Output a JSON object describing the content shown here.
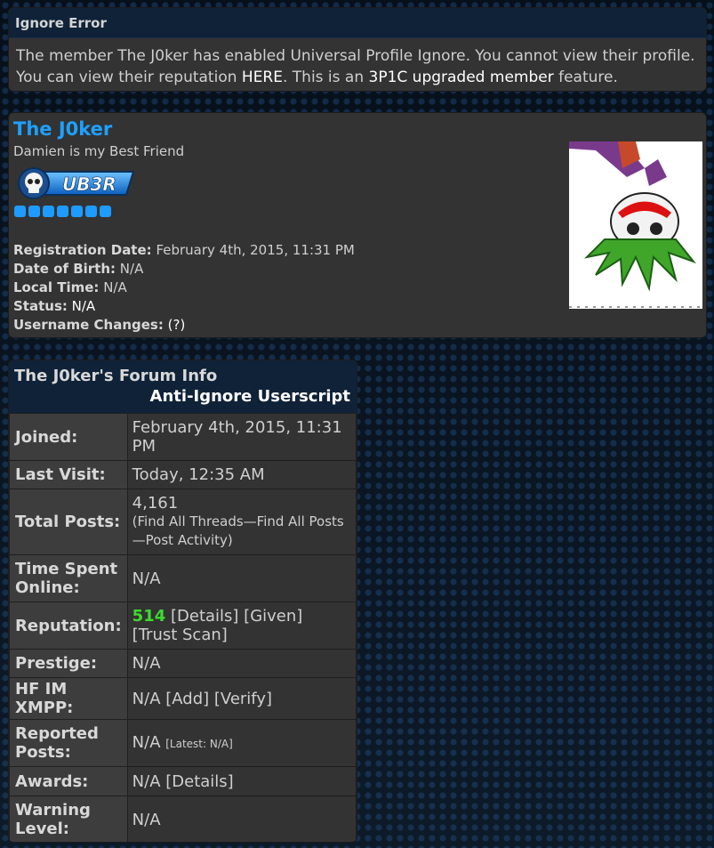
{
  "ignore_error": {
    "title": "Ignore Error",
    "msg_part1": "The member The J0ker has enabled Universal Profile Ignore. You cannot view their profile. You can view their reputation ",
    "here_link": "HERE",
    "msg_part2": ". This is an ",
    "upgrade_link": "3P1C upgraded member",
    "msg_part3": " feature."
  },
  "profile": {
    "username": "The J0ker",
    "user_title": "Damien is my Best Friend",
    "rank_badge_text": "UB3R",
    "rank_pips": 7,
    "registration_label": "Registration Date:",
    "registration_value": "February 4th, 2015, 11:31 PM",
    "dob_label": "Date of Birth:",
    "dob_value": "N/A",
    "localtime_label": "Local Time:",
    "localtime_value": "N/A",
    "status_label": "Status:",
    "status_value": "N/A",
    "username_changes_label": "Username Changes:",
    "username_changes_value": "(?)"
  },
  "forum_info": {
    "title": "The J0ker's Forum Info",
    "userscript_label": "Anti-Ignore Userscript",
    "joined_label": "Joined:",
    "joined_value": "February 4th, 2015, 11:31 PM",
    "last_visit_label": "Last Visit:",
    "last_visit_value": "Today, 12:35 AM",
    "total_posts_label": "Total Posts:",
    "total_posts_value": "4,161",
    "find_threads": "(Find All Threads",
    "find_posts": "Find All Posts",
    "post_activity": "Post Activity)",
    "time_online_label": "Time Spent Online:",
    "time_online_value": "N/A",
    "reputation_label": "Reputation:",
    "reputation_value": "514",
    "rep_details": "[Details]",
    "rep_given": "[Given]",
    "rep_trust_scan": "[Trust Scan]",
    "prestige_label": "Prestige:",
    "prestige_value": "N/A",
    "hfim_label": "HF IM XMPP:",
    "hfim_value": "N/A",
    "hfim_add": "[Add]",
    "hfim_verify": "[Verify]",
    "reported_label": "Reported Posts:",
    "reported_value": "N/A",
    "reported_latest": "[Latest: N/A]",
    "awards_label": "Awards:",
    "awards_value": "N/A",
    "awards_details": "[Details]",
    "warning_label": "Warning Level:",
    "warning_value": "N/A"
  }
}
